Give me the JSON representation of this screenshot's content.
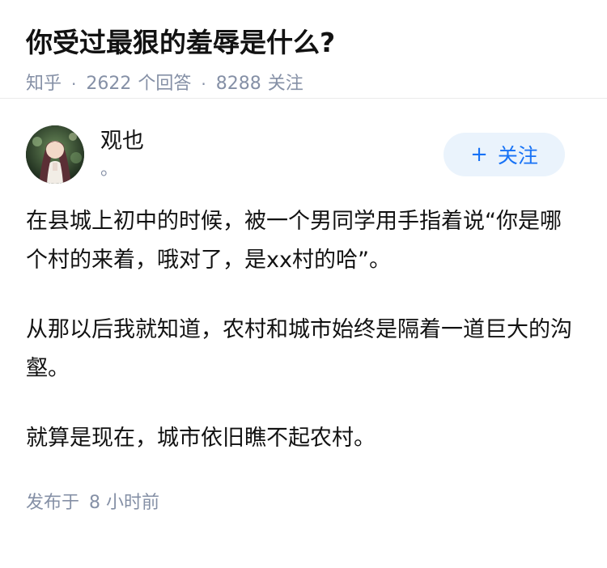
{
  "question": {
    "title": "你受过最狠的羞辱是什么?",
    "source": "知乎",
    "answer_count": "2622",
    "answer_label": "个回答",
    "follow_count": "8288",
    "follow_label": "关注",
    "separator": "·"
  },
  "answer": {
    "author_name": "观也",
    "author_bio": "。",
    "follow_button": {
      "icon": "plus-icon",
      "icon_glyph": "+",
      "label": "关注"
    },
    "paragraphs": [
      "在县城上初中的时候，被一个男同学用手指着说“你是哪个村的来着，哦对了，是xx村的哈”。",
      "从那以后我就知道，农村和城市始终是隔着一道巨大的沟壑。",
      "就算是现在，城市依旧瞧不起农村。"
    ],
    "published_prefix": "发布于",
    "published_time": "8 小时前"
  },
  "colors": {
    "text_primary": "#121212",
    "text_secondary": "#8590a6",
    "accent": "#1772f6",
    "button_bg": "#eaf3fc"
  }
}
